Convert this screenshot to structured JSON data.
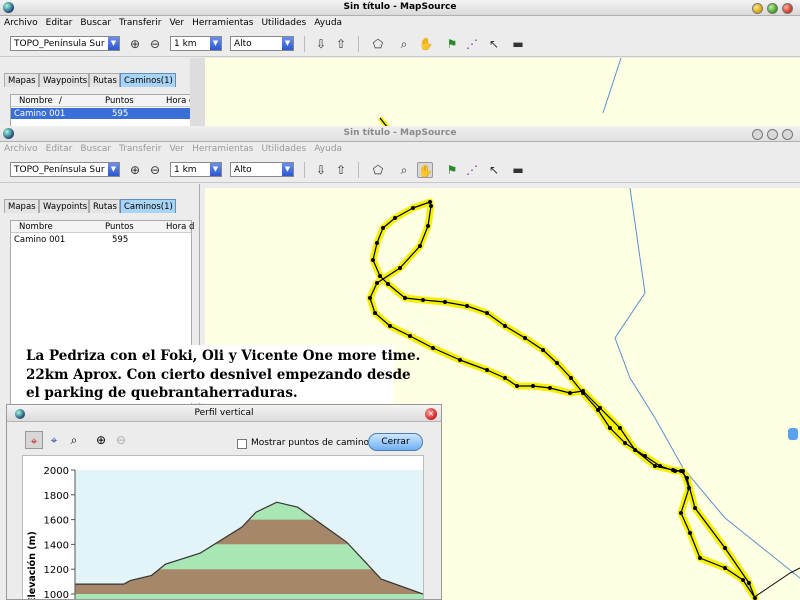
{
  "app": {
    "title": "Sin título - MapSource",
    "menu": [
      "Archivo",
      "Editar",
      "Buscar",
      "Transferir",
      "Ver",
      "Herramientas",
      "Utilidades",
      "Ayuda"
    ]
  },
  "toolbar": {
    "map_product": "TOPO_Península Sur",
    "zoom_scale": "1 km",
    "detail": "Alto"
  },
  "data_panel": {
    "tabs": [
      "Mapas",
      "Waypoints",
      "Rutas",
      "Caminos(1)"
    ],
    "selected_tab": "Caminos(1)",
    "columns": [
      "Nombre",
      "/",
      "Puntos",
      "Hora d"
    ],
    "rows": [
      {
        "name": "Camino 001",
        "points": "595"
      }
    ]
  },
  "caption": {
    "line1": "La Pedriza con el Foki, Oli y Vicente One more time.",
    "line2": "22km Aprox. Con cierto desnivel empezando desde",
    "line3": "el parking de quebrantaherraduras."
  },
  "profile_dialog": {
    "title": "Perfil vertical",
    "show_waypoints_label": "Mostrar puntos de camino",
    "show_waypoints_checked": false,
    "close_label": "Cerrar",
    "ylabel": "Elevación (m)"
  },
  "chart_data": {
    "type": "area",
    "ylabel": "Elevación (m)",
    "ylim": [
      1000,
      2000
    ],
    "yticks": [
      1000,
      1200,
      1400,
      1600,
      1800,
      2000
    ],
    "x": [
      0,
      0.04,
      0.14,
      0.16,
      0.22,
      0.26,
      0.36,
      0.4,
      0.48,
      0.52,
      0.58,
      0.64,
      0.7,
      0.78,
      0.84,
      0.88,
      1.0
    ],
    "y": [
      1080,
      1080,
      1080,
      1110,
      1150,
      1240,
      1330,
      1400,
      1540,
      1660,
      1740,
      1700,
      1580,
      1420,
      1240,
      1120,
      1000
    ]
  },
  "colors": {
    "map_bg": "#ffffe3",
    "track_highlight": "#f5f000",
    "track_line": "#000000",
    "water": "#5a8fd0",
    "band_green": "#a8e6b4",
    "band_brown": "#a6876a",
    "sky": "#e3f4f8"
  }
}
